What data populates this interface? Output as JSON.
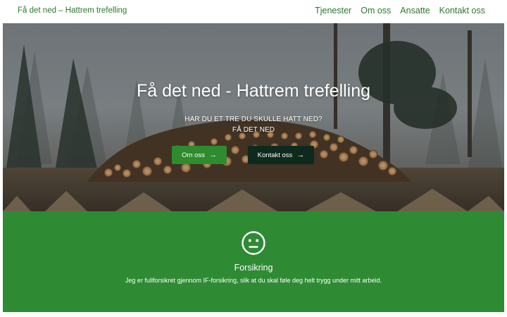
{
  "navbar": {
    "brand": "Få det ned – Hattrem trefelling",
    "links": [
      "Tjenester",
      "Om oss",
      "Ansatte",
      "Kontakt oss"
    ]
  },
  "hero": {
    "title": "Få det ned - Hattrem trefelling",
    "subtitle_line1": "HAR DU ET TRE DU SKULLE HATT NED?",
    "subtitle_line2": "FÅ DET NED",
    "buttons": {
      "om_oss": "Om oss",
      "kontakt_oss": "Kontakt oss"
    },
    "arrow_icon": "arrow-right-icon"
  },
  "feature": {
    "icon": "smiley-icon",
    "title": "Forsikring",
    "text": "Jeg er fullforsikret gjennom IF-forsikring, slik at du skal føle deg helt trygg under mitt arbeid."
  },
  "colors": {
    "brand_green": "#2a7a2e",
    "feature_green": "#2e8b34",
    "button_green": "#2e8b2e",
    "button_dark": "#0e2a1d"
  }
}
